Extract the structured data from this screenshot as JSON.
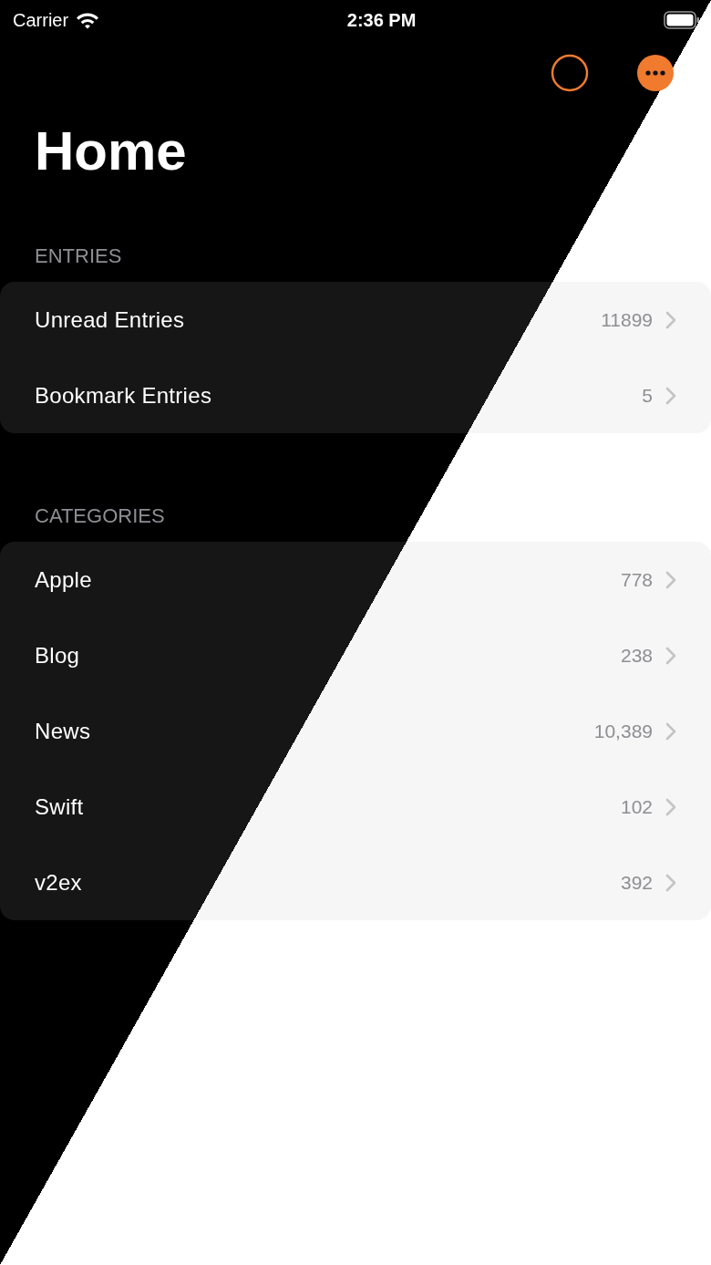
{
  "status_bar": {
    "carrier": "Carrier",
    "time": "2:36 PM"
  },
  "title": "Home",
  "sections": [
    {
      "header": "ENTRIES",
      "rows": [
        {
          "label": "Unread Entries",
          "count": "11899"
        },
        {
          "label": "Bookmark Entries",
          "count": "5"
        }
      ]
    },
    {
      "header": "CATEGORIES",
      "rows": [
        {
          "label": "Apple",
          "count": "778"
        },
        {
          "label": "Blog",
          "count": "238"
        },
        {
          "label": "News",
          "count": "10,389"
        },
        {
          "label": "Swift",
          "count": "102"
        },
        {
          "label": "v2ex",
          "count": "392"
        }
      ]
    }
  ]
}
